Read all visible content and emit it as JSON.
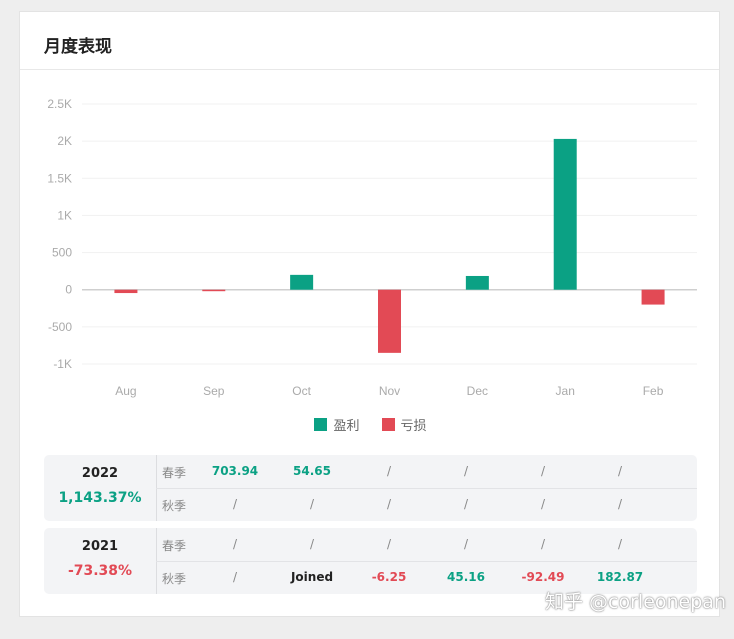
{
  "panel": {
    "title": "月度表现"
  },
  "legend": [
    {
      "label": "盈利",
      "color": "#0ba184"
    },
    {
      "label": "亏损",
      "color": "#e24a55"
    }
  ],
  "chart_data": {
    "type": "bar",
    "categories": [
      "Aug",
      "Sep",
      "Oct",
      "Nov",
      "Dec",
      "Jan",
      "Feb"
    ],
    "values": [
      -45,
      -20,
      200,
      -850,
      185,
      2030,
      -200
    ],
    "y_ticks": [
      "2.5K",
      "2K",
      "1.5K",
      "1K",
      "500",
      "0",
      "-500",
      "-1K"
    ],
    "ylim": [
      -1000,
      2500
    ],
    "positive_color": "#0ba184",
    "negative_color": "#e24a55",
    "grid": true
  },
  "years": [
    {
      "year": "2022",
      "total": "1,143.37%",
      "total_color": "#0ba184",
      "rows": [
        {
          "season": "春季",
          "cells": [
            {
              "text": "703.94",
              "kind": "pos"
            },
            {
              "text": "54.65",
              "kind": "pos"
            },
            {
              "text": "/",
              "kind": "slash"
            },
            {
              "text": "/",
              "kind": "slash"
            },
            {
              "text": "/",
              "kind": "slash"
            },
            {
              "text": "/",
              "kind": "slash"
            }
          ]
        },
        {
          "season": "秋季",
          "cells": [
            {
              "text": "/",
              "kind": "slash"
            },
            {
              "text": "/",
              "kind": "slash"
            },
            {
              "text": "/",
              "kind": "slash"
            },
            {
              "text": "/",
              "kind": "slash"
            },
            {
              "text": "/",
              "kind": "slash"
            },
            {
              "text": "/",
              "kind": "slash"
            }
          ]
        }
      ]
    },
    {
      "year": "2021",
      "total": "-73.38%",
      "total_color": "#e24a55",
      "rows": [
        {
          "season": "春季",
          "cells": [
            {
              "text": "/",
              "kind": "slash"
            },
            {
              "text": "/",
              "kind": "slash"
            },
            {
              "text": "/",
              "kind": "slash"
            },
            {
              "text": "/",
              "kind": "slash"
            },
            {
              "text": "/",
              "kind": "slash"
            },
            {
              "text": "/",
              "kind": "slash"
            }
          ]
        },
        {
          "season": "秋季",
          "cells": [
            {
              "text": "/",
              "kind": "slash"
            },
            {
              "text": "Joined",
              "kind": "text"
            },
            {
              "text": "-6.25",
              "kind": "neg"
            },
            {
              "text": "45.16",
              "kind": "pos"
            },
            {
              "text": "-92.49",
              "kind": "neg"
            },
            {
              "text": "182.87",
              "kind": "pos"
            }
          ]
        }
      ]
    }
  ],
  "watermark": "知乎 @corleonepan"
}
